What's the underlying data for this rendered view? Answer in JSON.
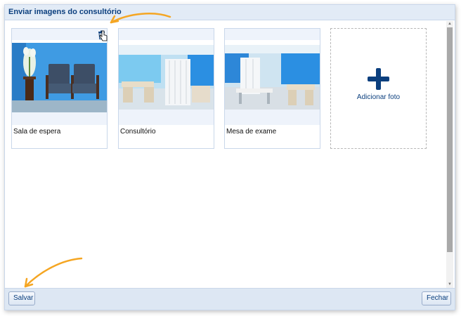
{
  "dialog": {
    "title": "Enviar imagens do consultório"
  },
  "photos": [
    {
      "label": "Sala de espera",
      "image": "waiting-room-chairs"
    },
    {
      "label": "Consultório",
      "image": "consulting-room"
    },
    {
      "label": "Mesa de exame",
      "image": "exam-table-room"
    }
  ],
  "add_photo": {
    "label": "Adicionar foto",
    "icon": "plus-icon"
  },
  "footer": {
    "save_label": "Salvar",
    "close_label": "Fechar"
  },
  "icons": {
    "delete": "trash-icon"
  },
  "colors": {
    "accent": "#0b3f7e",
    "annotation_arrow": "#f5a623",
    "header_bg": "#e2ebf6",
    "photo_wall_blue": "#2f8fd8"
  }
}
